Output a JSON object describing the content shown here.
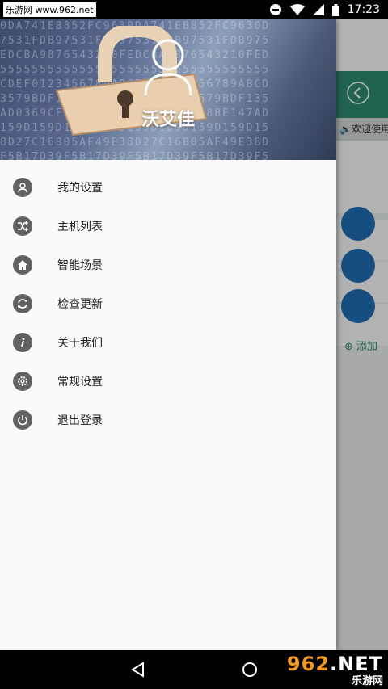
{
  "statusbar": {
    "watermark": "乐游网 www.962.net",
    "time": "17:23"
  },
  "background_app": {
    "notice_text": "欢迎使用",
    "add_label": "添加"
  },
  "drawer": {
    "username": "沃艾佳",
    "menu": [
      {
        "label": "我的设置",
        "icon": "person-icon"
      },
      {
        "label": "主机列表",
        "icon": "shuffle-icon"
      },
      {
        "label": "智能场景",
        "icon": "home-icon"
      },
      {
        "label": "检查更新",
        "icon": "refresh-icon"
      },
      {
        "label": "关于我们",
        "icon": "info-icon"
      },
      {
        "label": "常规设置",
        "icon": "gear-icon"
      },
      {
        "label": "退出登录",
        "icon": "power-icon"
      }
    ]
  },
  "watermark_logo": {
    "number": "962",
    "suffix": ".NET",
    "text": "乐游网"
  },
  "colors": {
    "accent_green": "#2e8a74",
    "icon_gray": "#616161",
    "drawer_bg": "#fafafa"
  }
}
